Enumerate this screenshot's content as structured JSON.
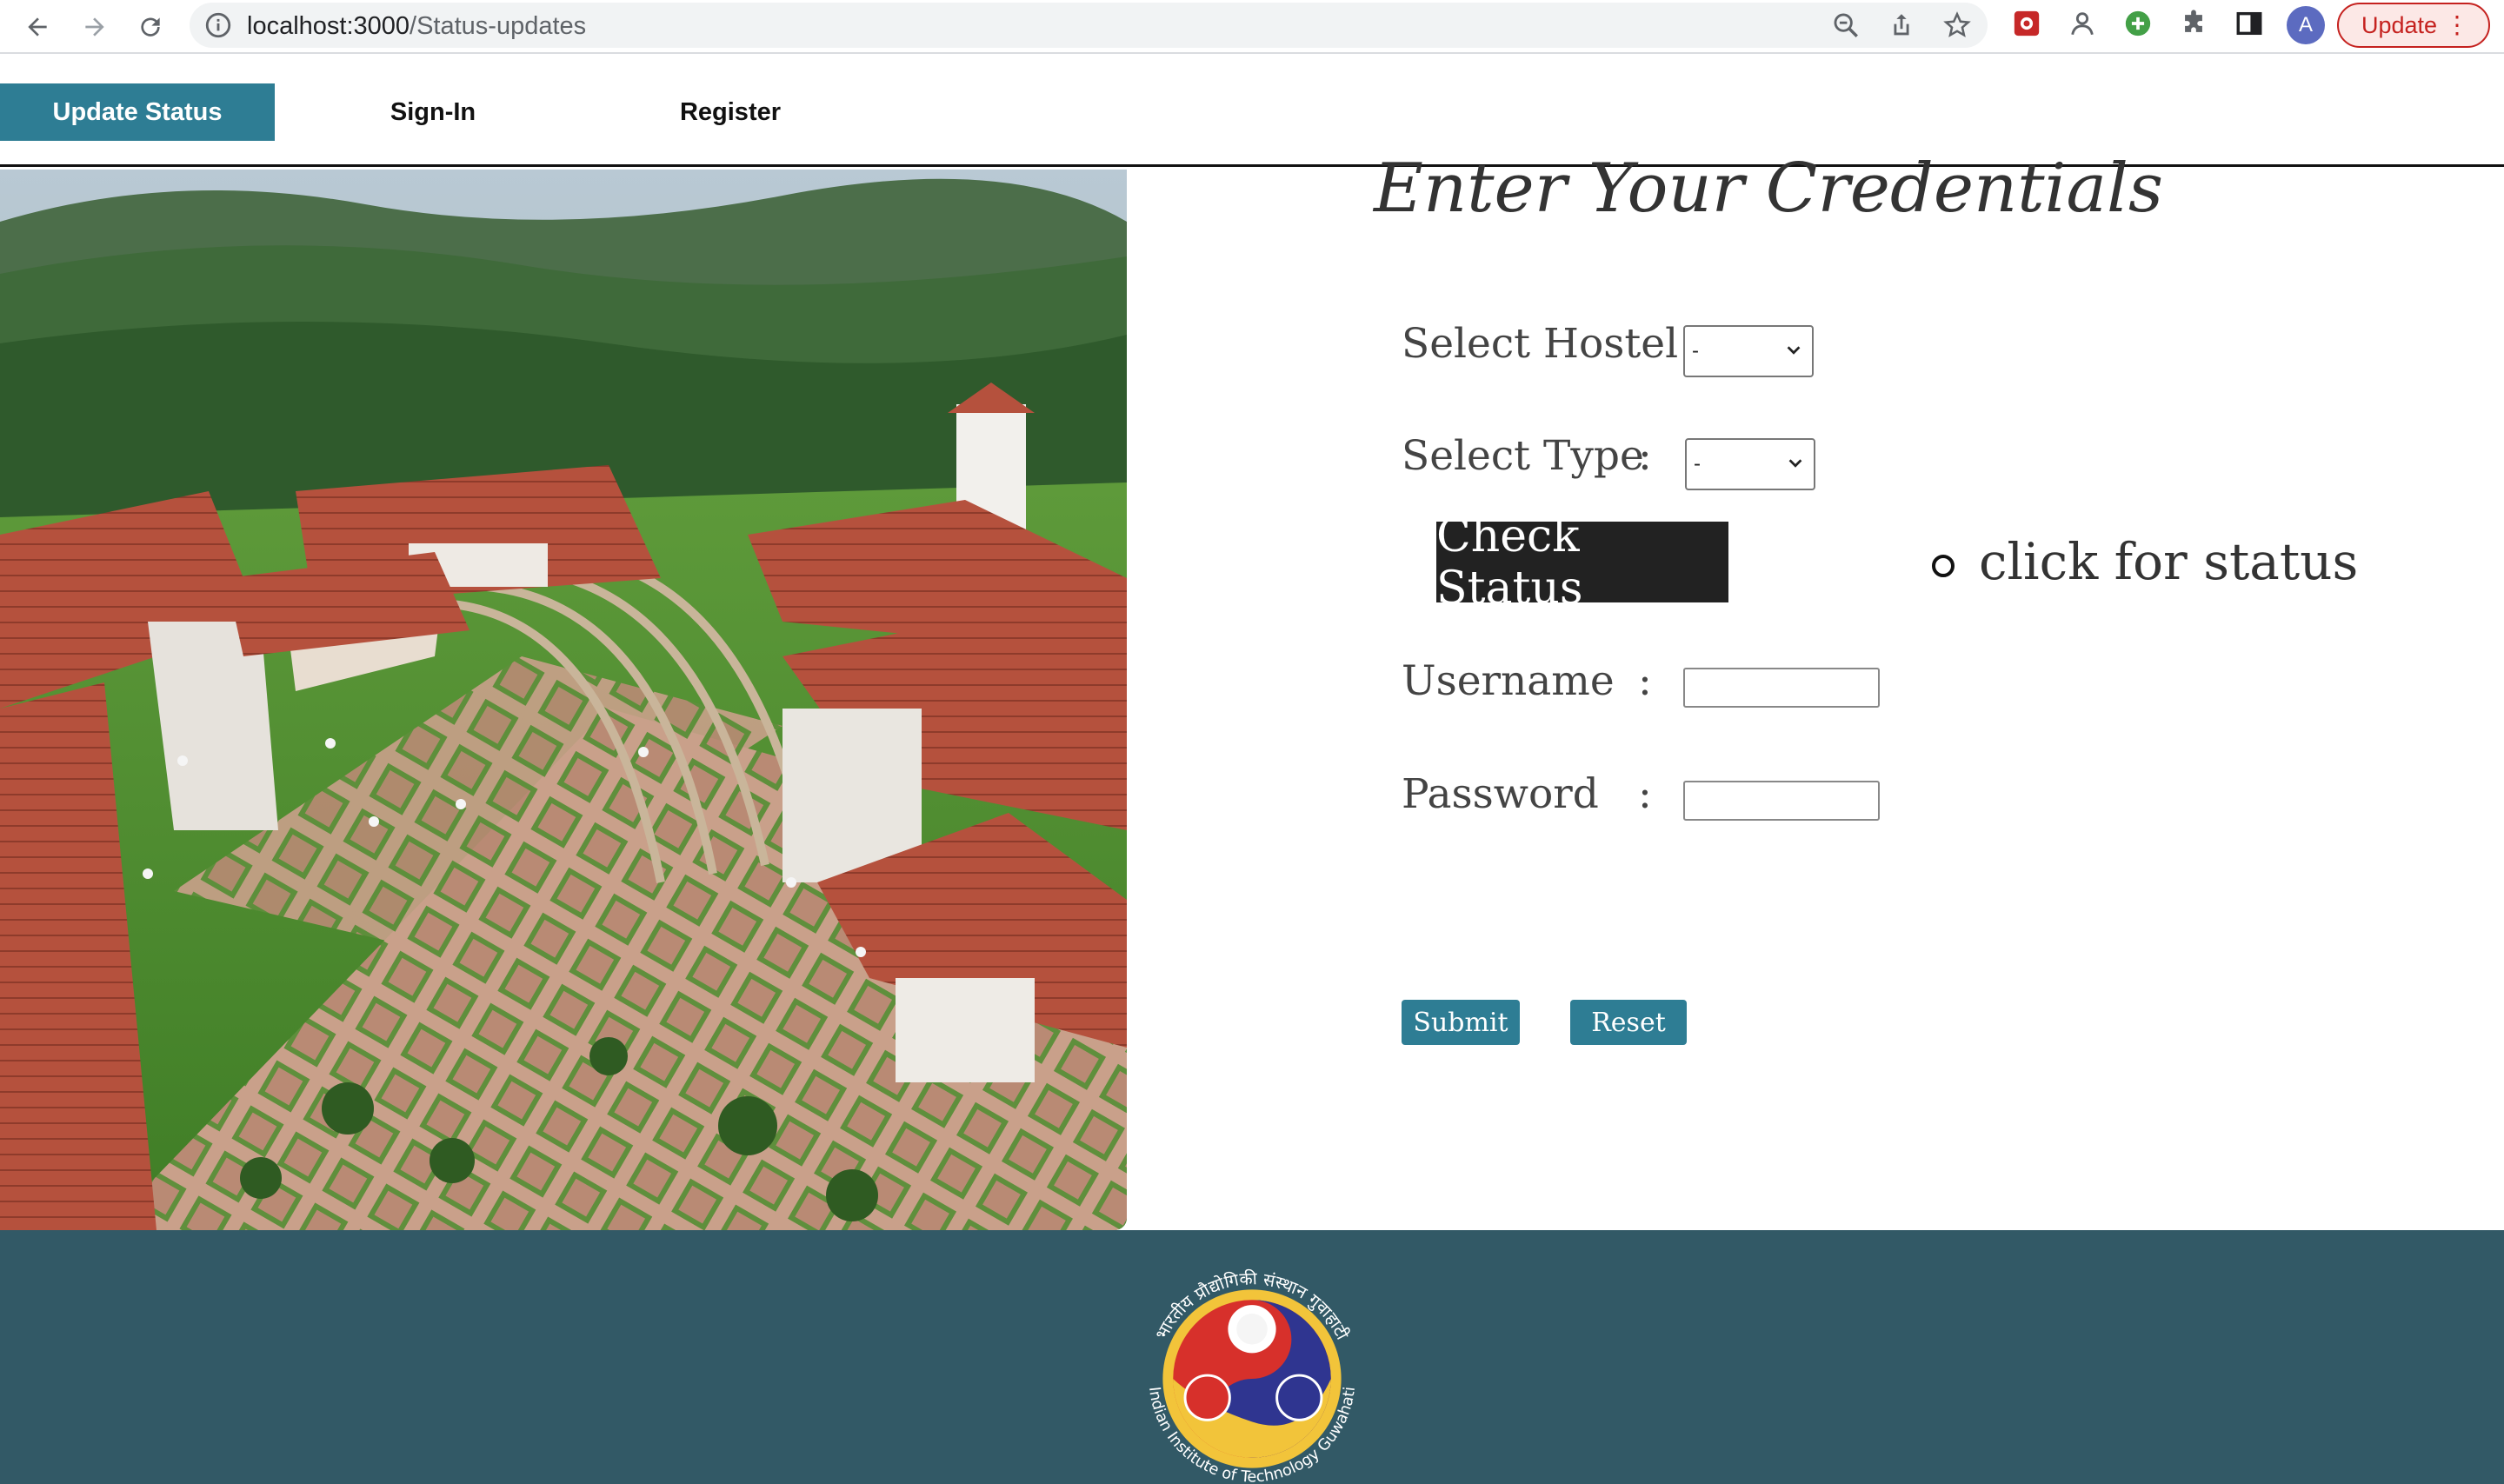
{
  "browser": {
    "url_host": "localhost:3000",
    "url_path": "/Status-updates",
    "profile_initial": "A",
    "update_label": "Update",
    "icons": [
      "back-icon",
      "forward-icon",
      "reload-icon",
      "info-icon",
      "zoom-icon",
      "share-icon",
      "bookmark-star-icon",
      "extension-icon",
      "puzzle-icon",
      "side-panel-icon",
      "kebab-menu-icon"
    ]
  },
  "nav": {
    "items": [
      {
        "label": "Update Status",
        "active": true
      },
      {
        "label": "Sign-In",
        "active": false
      },
      {
        "label": "Register",
        "active": false
      }
    ]
  },
  "form": {
    "title": "Enter Your Credentials",
    "hostel_label": "Select Hostel :",
    "hostel_value": "-",
    "type_label": "Select Type",
    "type_value": "-",
    "colon": ":",
    "check_status_label": "Check Status",
    "radio_label": "click for status",
    "username_label": "Username",
    "username_value": "",
    "password_label": "Password",
    "password_value": "",
    "submit_label": "Submit",
    "reset_label": "Reset"
  },
  "footer": {
    "logo_text_top": "भारतीय प्रौद्योगिकी संस्थान गुवाहाटी",
    "logo_text_bottom": "Indian Institute of Technology Guwahati"
  },
  "colors": {
    "accent": "#2e7d94",
    "footer_bg": "#325966",
    "check_button_bg": "#222222"
  }
}
